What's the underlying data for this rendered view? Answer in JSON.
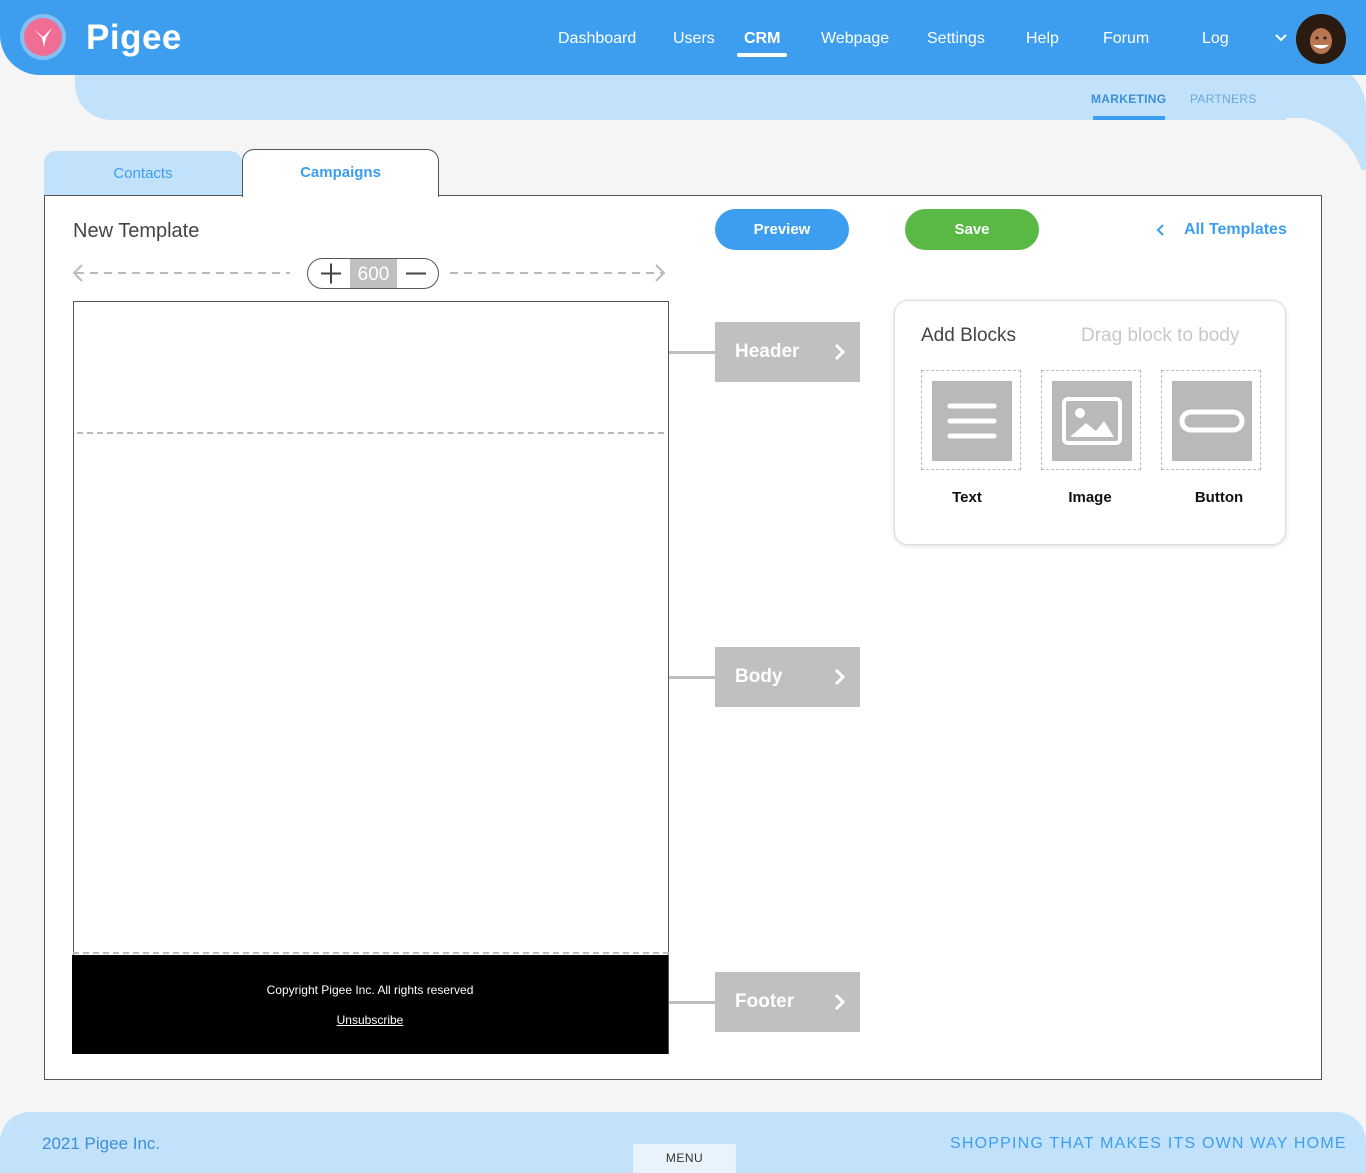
{
  "app": {
    "brand": "Pigee"
  },
  "nav": {
    "items": [
      {
        "label": "Dashboard"
      },
      {
        "label": "Users"
      },
      {
        "label": "CRM",
        "active": true
      },
      {
        "label": "Webpage"
      },
      {
        "label": "Settings"
      },
      {
        "label": "Help"
      },
      {
        "label": "Forum"
      },
      {
        "label": "Log"
      }
    ]
  },
  "subnav": {
    "items": [
      {
        "label": "MARKETING",
        "active": true
      },
      {
        "label": "PARTNERS"
      }
    ]
  },
  "tabs": {
    "contacts": "Contacts",
    "campaigns": "Campaigns"
  },
  "editor": {
    "title": "New Template",
    "preview_label": "Preview",
    "save_label": "Save",
    "all_templates_label": "All Templates",
    "width_value": "600",
    "sections": {
      "header": "Header",
      "body": "Body",
      "footer": "Footer"
    },
    "footer_preview": {
      "copyright": "Copyright Pigee Inc. All rights reserved",
      "unsubscribe": "Unsubscribe"
    }
  },
  "blocks": {
    "title": "Add Blocks",
    "hint": "Drag block to body",
    "items": [
      {
        "label": "Text",
        "icon": "text-lines-icon"
      },
      {
        "label": "Image",
        "icon": "image-icon"
      },
      {
        "label": "Button",
        "icon": "button-icon"
      }
    ]
  },
  "footer": {
    "left": "2021 Pigee Inc.",
    "right": "SHOPPING THAT MAKES ITS OWN WAY HOME",
    "menu": "MENU"
  },
  "colors": {
    "primary": "#3d9ef0",
    "light": "#c2e2fb",
    "save": "#5ab845",
    "logo": "#f06d93",
    "block_grey": "#c0c0c0"
  }
}
